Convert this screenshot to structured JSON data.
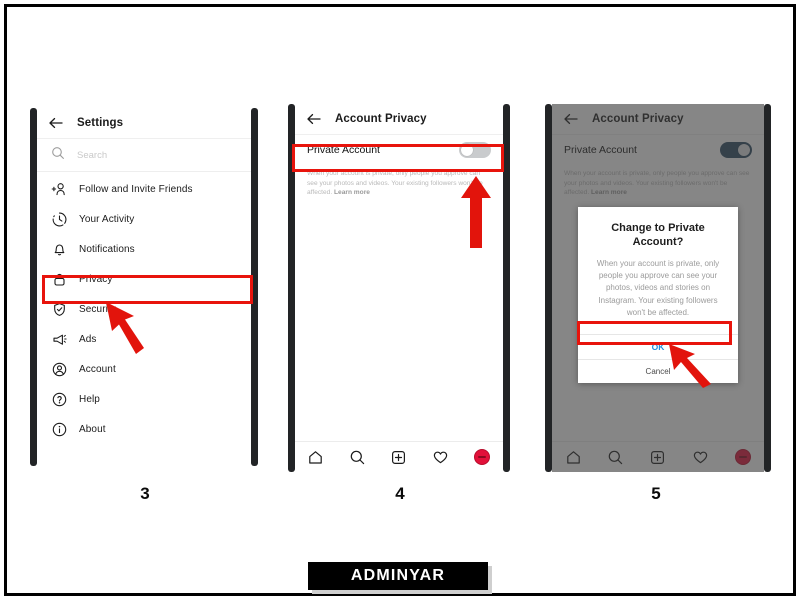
{
  "meta": {
    "colors": {
      "highlight_red": "#e8140c",
      "arrow_red": "#e2140c",
      "link_blue": "#1f8fe0",
      "toggle_on": "#2a4a63",
      "toggle_off": "#c9cbcd",
      "avatar_red": "#e2113a",
      "text_dark": "#1b1b1b",
      "text_muted": "#b9b9b9",
      "frame_black": "#000000"
    }
  },
  "watermark": {
    "label": "ADMINYAR"
  },
  "steps": [
    {
      "number": "3"
    },
    {
      "number": "4"
    },
    {
      "number": "5"
    }
  ],
  "phone1": {
    "appbar": {
      "title": "Settings",
      "back_icon": "back-arrow-icon"
    },
    "search": {
      "placeholder": "Search",
      "icon": "search-icon"
    },
    "items": [
      {
        "label": "Follow and Invite Friends",
        "icon": "add-person-icon"
      },
      {
        "label": "Your Activity",
        "icon": "clock-activity-icon"
      },
      {
        "label": "Notifications",
        "icon": "bell-icon"
      },
      {
        "label": "Privacy",
        "icon": "lock-icon",
        "highlighted": true
      },
      {
        "label": "Security",
        "icon": "shield-icon"
      },
      {
        "label": "Ads",
        "icon": "megaphone-icon"
      },
      {
        "label": "Account",
        "icon": "account-circle-icon"
      },
      {
        "label": "Help",
        "icon": "help-circle-icon"
      },
      {
        "label": "About",
        "icon": "info-circle-icon"
      }
    ]
  },
  "phone2": {
    "appbar": {
      "title": "Account Privacy",
      "back_icon": "back-arrow-icon"
    },
    "toggle": {
      "label": "Private Account",
      "state": "off",
      "highlighted": true
    },
    "helper": {
      "text": "When your account is private, only people you approve can see your photos and videos. Your existing followers won't be affected. ",
      "link": "Learn more"
    },
    "bottomnav": [
      {
        "icon": "home-icon"
      },
      {
        "icon": "search-icon"
      },
      {
        "icon": "add-post-icon"
      },
      {
        "icon": "heart-icon"
      },
      {
        "icon": "profile-avatar-icon"
      }
    ]
  },
  "phone3": {
    "appbar": {
      "title": "Account Privacy",
      "back_icon": "back-arrow-icon"
    },
    "toggle": {
      "label": "Private Account",
      "state": "on"
    },
    "helper": {
      "text": "When your account is private, only people you approve can see your photos and videos. Your existing followers won't be affected. ",
      "link": "Learn more"
    },
    "dialog": {
      "title": "Change to Private Account?",
      "body": "When your account is private, only people you approve can see your photos, videos and stories on Instagram. Your existing followers won't be affected.",
      "ok_label": "OK",
      "cancel_label": "Cancel",
      "ok_highlighted": true
    },
    "bottomnav": [
      {
        "icon": "home-icon"
      },
      {
        "icon": "search-icon"
      },
      {
        "icon": "add-post-icon"
      },
      {
        "icon": "heart-icon"
      },
      {
        "icon": "profile-avatar-icon"
      }
    ]
  }
}
